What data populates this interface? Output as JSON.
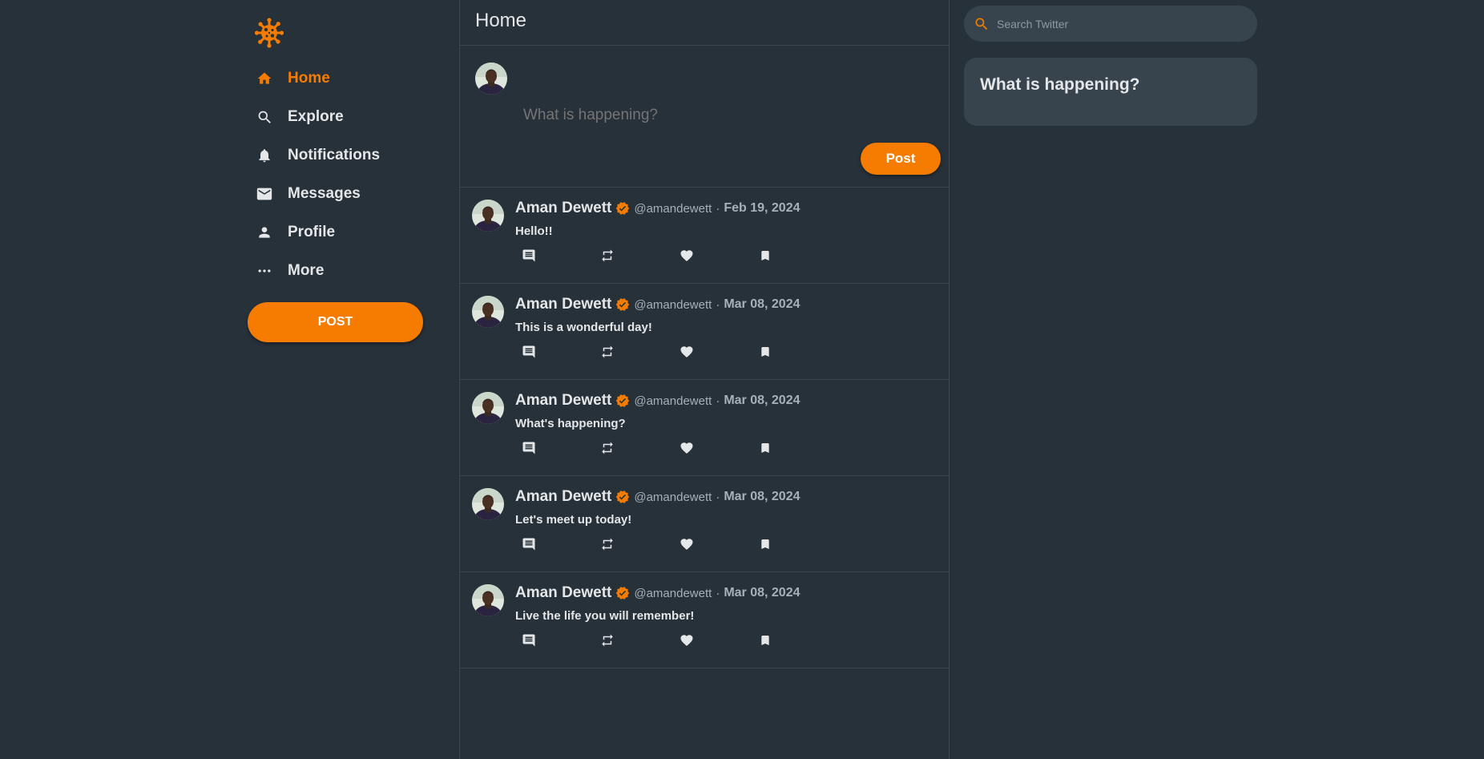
{
  "colors": {
    "accent": "#f57c00",
    "background": "#27313a",
    "card": "#37444d",
    "text": "#e4e6e8",
    "muted": "#a8b0b7"
  },
  "logo": {
    "icon": "virus-icon"
  },
  "nav": {
    "items": [
      {
        "label": "Home",
        "icon": "home-icon",
        "active": true
      },
      {
        "label": "Explore",
        "icon": "search-icon",
        "active": false
      },
      {
        "label": "Notifications",
        "icon": "bell-icon",
        "active": false
      },
      {
        "label": "Messages",
        "icon": "mail-icon",
        "active": false
      },
      {
        "label": "Profile",
        "icon": "person-icon",
        "active": false
      },
      {
        "label": "More",
        "icon": "more-icon",
        "active": false
      }
    ],
    "post_label": "POST"
  },
  "header": {
    "title": "Home"
  },
  "composer": {
    "placeholder": "What is happening?",
    "post_label": "Post"
  },
  "tweets": [
    {
      "name": "Aman Dewett",
      "handle": "@amandewett",
      "separator": "·",
      "date": "Feb 19, 2024",
      "text": "Hello!!"
    },
    {
      "name": "Aman Dewett",
      "handle": "@amandewett",
      "separator": "·",
      "date": "Mar 08, 2024",
      "text": "This is a wonderful day!"
    },
    {
      "name": "Aman Dewett",
      "handle": "@amandewett",
      "separator": "·",
      "date": "Mar 08, 2024",
      "text": "What's happening?"
    },
    {
      "name": "Aman Dewett",
      "handle": "@amandewett",
      "separator": "·",
      "date": "Mar 08, 2024",
      "text": "Let's meet up today!"
    },
    {
      "name": "Aman Dewett",
      "handle": "@amandewett",
      "separator": "·",
      "date": "Mar 08, 2024",
      "text": "Live the life you will remember!"
    }
  ],
  "search": {
    "placeholder": "Search Twitter"
  },
  "trends": {
    "title": "What is happening?"
  }
}
